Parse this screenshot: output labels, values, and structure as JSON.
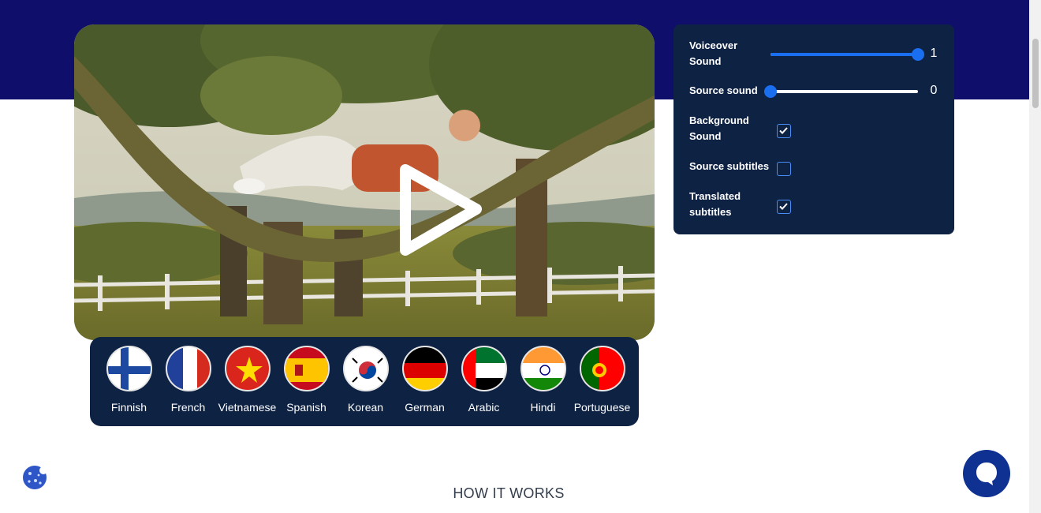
{
  "video": {
    "play_icon": "play-icon"
  },
  "languages": [
    {
      "label": "Finnish"
    },
    {
      "label": "French"
    },
    {
      "label": "Vietnamese"
    },
    {
      "label": "Spanish"
    },
    {
      "label": "Korean"
    },
    {
      "label": "German"
    },
    {
      "label": "Arabic"
    },
    {
      "label": "Hindi"
    },
    {
      "label": "Portuguese"
    }
  ],
  "panel": {
    "voiceover_label_1": "Voiceover",
    "voiceover_label_2": "Sound",
    "voiceover_value": "1",
    "voiceover_level": 1,
    "source_label": "Source sound",
    "source_value": "0",
    "source_level": 0,
    "background_label_1": "Background",
    "background_label_2": "Sound",
    "background_checked": true,
    "source_subtitles_label": "Source subtitles",
    "source_subtitles_checked": false,
    "translated_label_1": "Translated",
    "translated_label_2": "subtitles",
    "translated_checked": true
  },
  "section": {
    "how_it_works": "HOW IT WORKS"
  },
  "colors": {
    "header": "#0f0f6b",
    "panel": "#0e2244",
    "accent": "#1a6ff0",
    "chat": "#0f3192"
  }
}
